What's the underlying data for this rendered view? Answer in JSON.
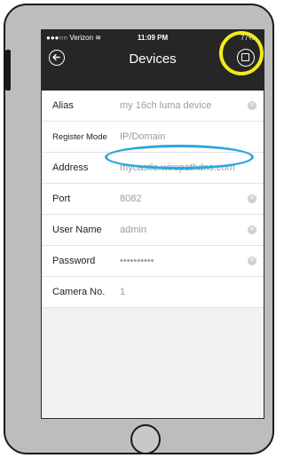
{
  "status": {
    "carrier": "●●●○○ Verizon ≋",
    "time": "11:09 PM",
    "battery": "77%"
  },
  "nav": {
    "title": "Devices",
    "back_icon": "back-arrow-icon",
    "save_icon": "save-icon"
  },
  "fields": [
    {
      "label": "Alias",
      "value": "my 16ch luma device",
      "clear": true
    },
    {
      "label": "Register Mode",
      "value": "IP/Domain",
      "clear": false
    },
    {
      "label": "Address",
      "value": "mycastle.wirepathdns.com",
      "clear": false
    },
    {
      "label": "Port",
      "value": "8082",
      "clear": true
    },
    {
      "label": "User Name",
      "value": "admin",
      "clear": true
    },
    {
      "label": "Password",
      "value": "••••••••••",
      "clear": true
    },
    {
      "label": "Camera No.",
      "value": "1",
      "clear": false
    }
  ],
  "colors": {
    "highlight_yellow": "#f3ea1c",
    "highlight_blue": "#2aa7dc",
    "topbar": "#262626"
  }
}
